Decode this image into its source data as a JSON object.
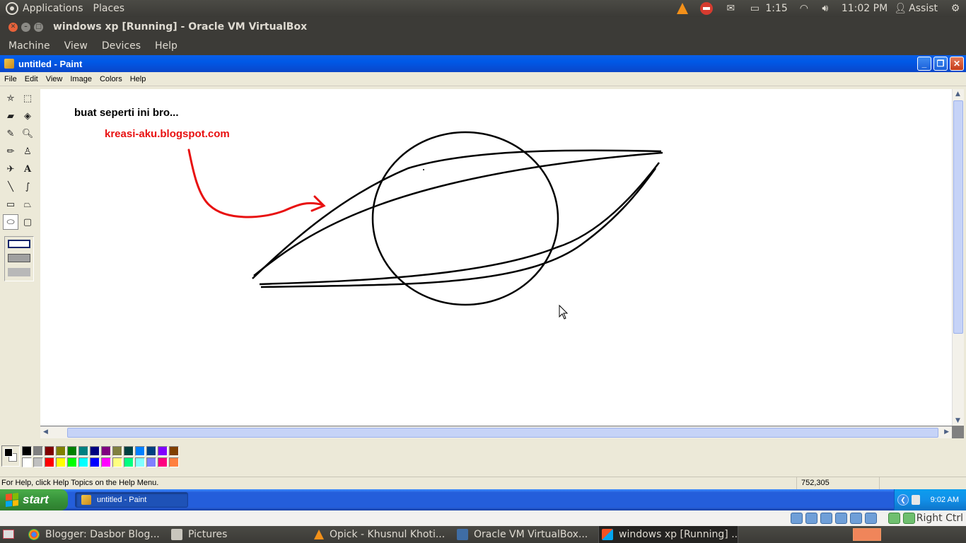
{
  "ubuntu_top_panel": {
    "menus": [
      "Applications",
      "Places"
    ],
    "battery_time": "1:15",
    "clock": "11:02 PM",
    "user": "Assist"
  },
  "vbox": {
    "title": "windows xp [Running] - Oracle VM VirtualBox",
    "menus": [
      "Machine",
      "View",
      "Devices",
      "Help"
    ],
    "host_key": "Right Ctrl"
  },
  "paint": {
    "title": "untitled - Paint",
    "menus": [
      "File",
      "Edit",
      "View",
      "Image",
      "Colors",
      "Help"
    ],
    "canvas_text_1": "buat seperti ini bro...",
    "canvas_text_2": "kreasi-aku.blogspot.com",
    "status_help": "For Help, click Help Topics on the Help Menu.",
    "status_coords": "752,305",
    "palette_colors": {
      "row1": [
        "#000000",
        "#808080",
        "#800000",
        "#808000",
        "#008000",
        "#008080",
        "#000080",
        "#800080",
        "#808040",
        "#004040",
        "#0080ff",
        "#004080",
        "#8000ff",
        "#804000"
      ],
      "row2": [
        "#ffffff",
        "#c0c0c0",
        "#ff0000",
        "#ffff00",
        "#00ff00",
        "#00ffff",
        "#0000ff",
        "#ff00ff",
        "#ffff80",
        "#00ff80",
        "#80ffff",
        "#8080ff",
        "#ff0080",
        "#ff8040"
      ]
    },
    "foreground_color": "#000000",
    "background_color": "#ffffff"
  },
  "xp_taskbar": {
    "start_label": "start",
    "task_label": "untitled - Paint",
    "clock": "9:02 AM"
  },
  "ubuntu_bottom_panel": {
    "items": [
      "Blogger: Dasbor Blog...",
      "Pictures",
      "Opick - Khusnul Khoti...",
      "Oracle VM VirtualBox...",
      "windows xp [Running] ..."
    ]
  }
}
